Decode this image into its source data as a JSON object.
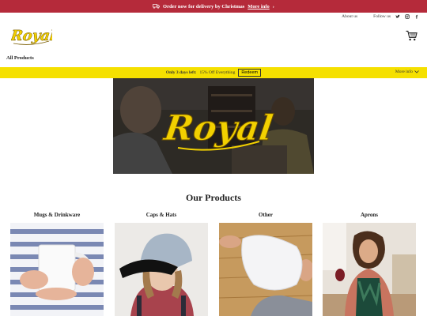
{
  "announcement": {
    "text": "Order now for delivery by Christmas",
    "link": "More info",
    "chevron": "›",
    "icon": "truck-icon"
  },
  "toplinks": {
    "about": "About us",
    "follow": "Follow us",
    "icons": [
      "twitter-icon",
      "instagram-icon",
      "facebook-icon"
    ]
  },
  "brand": {
    "logo_text": "Royal",
    "accent": "#f2d000"
  },
  "nav": {
    "all_products": "All Products"
  },
  "promo": {
    "bold": "Only 3 days left:",
    "text": "15% Off Everything",
    "button": "Redeem",
    "more": "More info"
  },
  "colors": {
    "announce_bg": "#b52a3a",
    "promo_bg": "#f5e000"
  },
  "products": {
    "title": "Our Products",
    "categories": [
      {
        "label": "Mugs & Drinkware"
      },
      {
        "label": "Caps & Hats"
      },
      {
        "label": "Other"
      },
      {
        "label": "Aprons"
      }
    ]
  }
}
